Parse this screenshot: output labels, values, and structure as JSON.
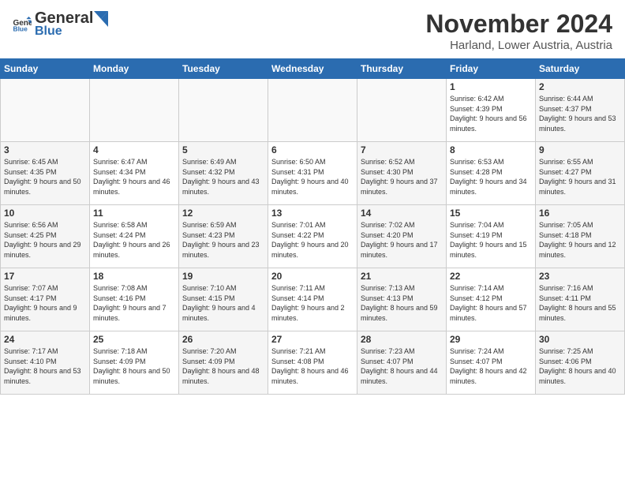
{
  "logo": {
    "general": "General",
    "blue": "Blue"
  },
  "header": {
    "month": "November 2024",
    "location": "Harland, Lower Austria, Austria"
  },
  "weekdays": [
    "Sunday",
    "Monday",
    "Tuesday",
    "Wednesday",
    "Thursday",
    "Friday",
    "Saturday"
  ],
  "weeks": [
    [
      {
        "day": "",
        "sunrise": "",
        "sunset": "",
        "daylight": ""
      },
      {
        "day": "",
        "sunrise": "",
        "sunset": "",
        "daylight": ""
      },
      {
        "day": "",
        "sunrise": "",
        "sunset": "",
        "daylight": ""
      },
      {
        "day": "",
        "sunrise": "",
        "sunset": "",
        "daylight": ""
      },
      {
        "day": "",
        "sunrise": "",
        "sunset": "",
        "daylight": ""
      },
      {
        "day": "1",
        "sunrise": "Sunrise: 6:42 AM",
        "sunset": "Sunset: 4:39 PM",
        "daylight": "Daylight: 9 hours and 56 minutes."
      },
      {
        "day": "2",
        "sunrise": "Sunrise: 6:44 AM",
        "sunset": "Sunset: 4:37 PM",
        "daylight": "Daylight: 9 hours and 53 minutes."
      }
    ],
    [
      {
        "day": "3",
        "sunrise": "Sunrise: 6:45 AM",
        "sunset": "Sunset: 4:35 PM",
        "daylight": "Daylight: 9 hours and 50 minutes."
      },
      {
        "day": "4",
        "sunrise": "Sunrise: 6:47 AM",
        "sunset": "Sunset: 4:34 PM",
        "daylight": "Daylight: 9 hours and 46 minutes."
      },
      {
        "day": "5",
        "sunrise": "Sunrise: 6:49 AM",
        "sunset": "Sunset: 4:32 PM",
        "daylight": "Daylight: 9 hours and 43 minutes."
      },
      {
        "day": "6",
        "sunrise": "Sunrise: 6:50 AM",
        "sunset": "Sunset: 4:31 PM",
        "daylight": "Daylight: 9 hours and 40 minutes."
      },
      {
        "day": "7",
        "sunrise": "Sunrise: 6:52 AM",
        "sunset": "Sunset: 4:30 PM",
        "daylight": "Daylight: 9 hours and 37 minutes."
      },
      {
        "day": "8",
        "sunrise": "Sunrise: 6:53 AM",
        "sunset": "Sunset: 4:28 PM",
        "daylight": "Daylight: 9 hours and 34 minutes."
      },
      {
        "day": "9",
        "sunrise": "Sunrise: 6:55 AM",
        "sunset": "Sunset: 4:27 PM",
        "daylight": "Daylight: 9 hours and 31 minutes."
      }
    ],
    [
      {
        "day": "10",
        "sunrise": "Sunrise: 6:56 AM",
        "sunset": "Sunset: 4:25 PM",
        "daylight": "Daylight: 9 hours and 29 minutes."
      },
      {
        "day": "11",
        "sunrise": "Sunrise: 6:58 AM",
        "sunset": "Sunset: 4:24 PM",
        "daylight": "Daylight: 9 hours and 26 minutes."
      },
      {
        "day": "12",
        "sunrise": "Sunrise: 6:59 AM",
        "sunset": "Sunset: 4:23 PM",
        "daylight": "Daylight: 9 hours and 23 minutes."
      },
      {
        "day": "13",
        "sunrise": "Sunrise: 7:01 AM",
        "sunset": "Sunset: 4:22 PM",
        "daylight": "Daylight: 9 hours and 20 minutes."
      },
      {
        "day": "14",
        "sunrise": "Sunrise: 7:02 AM",
        "sunset": "Sunset: 4:20 PM",
        "daylight": "Daylight: 9 hours and 17 minutes."
      },
      {
        "day": "15",
        "sunrise": "Sunrise: 7:04 AM",
        "sunset": "Sunset: 4:19 PM",
        "daylight": "Daylight: 9 hours and 15 minutes."
      },
      {
        "day": "16",
        "sunrise": "Sunrise: 7:05 AM",
        "sunset": "Sunset: 4:18 PM",
        "daylight": "Daylight: 9 hours and 12 minutes."
      }
    ],
    [
      {
        "day": "17",
        "sunrise": "Sunrise: 7:07 AM",
        "sunset": "Sunset: 4:17 PM",
        "daylight": "Daylight: 9 hours and 9 minutes."
      },
      {
        "day": "18",
        "sunrise": "Sunrise: 7:08 AM",
        "sunset": "Sunset: 4:16 PM",
        "daylight": "Daylight: 9 hours and 7 minutes."
      },
      {
        "day": "19",
        "sunrise": "Sunrise: 7:10 AM",
        "sunset": "Sunset: 4:15 PM",
        "daylight": "Daylight: 9 hours and 4 minutes."
      },
      {
        "day": "20",
        "sunrise": "Sunrise: 7:11 AM",
        "sunset": "Sunset: 4:14 PM",
        "daylight": "Daylight: 9 hours and 2 minutes."
      },
      {
        "day": "21",
        "sunrise": "Sunrise: 7:13 AM",
        "sunset": "Sunset: 4:13 PM",
        "daylight": "Daylight: 8 hours and 59 minutes."
      },
      {
        "day": "22",
        "sunrise": "Sunrise: 7:14 AM",
        "sunset": "Sunset: 4:12 PM",
        "daylight": "Daylight: 8 hours and 57 minutes."
      },
      {
        "day": "23",
        "sunrise": "Sunrise: 7:16 AM",
        "sunset": "Sunset: 4:11 PM",
        "daylight": "Daylight: 8 hours and 55 minutes."
      }
    ],
    [
      {
        "day": "24",
        "sunrise": "Sunrise: 7:17 AM",
        "sunset": "Sunset: 4:10 PM",
        "daylight": "Daylight: 8 hours and 53 minutes."
      },
      {
        "day": "25",
        "sunrise": "Sunrise: 7:18 AM",
        "sunset": "Sunset: 4:09 PM",
        "daylight": "Daylight: 8 hours and 50 minutes."
      },
      {
        "day": "26",
        "sunrise": "Sunrise: 7:20 AM",
        "sunset": "Sunset: 4:09 PM",
        "daylight": "Daylight: 8 hours and 48 minutes."
      },
      {
        "day": "27",
        "sunrise": "Sunrise: 7:21 AM",
        "sunset": "Sunset: 4:08 PM",
        "daylight": "Daylight: 8 hours and 46 minutes."
      },
      {
        "day": "28",
        "sunrise": "Sunrise: 7:23 AM",
        "sunset": "Sunset: 4:07 PM",
        "daylight": "Daylight: 8 hours and 44 minutes."
      },
      {
        "day": "29",
        "sunrise": "Sunrise: 7:24 AM",
        "sunset": "Sunset: 4:07 PM",
        "daylight": "Daylight: 8 hours and 42 minutes."
      },
      {
        "day": "30",
        "sunrise": "Sunrise: 7:25 AM",
        "sunset": "Sunset: 4:06 PM",
        "daylight": "Daylight: 8 hours and 40 minutes."
      }
    ]
  ]
}
